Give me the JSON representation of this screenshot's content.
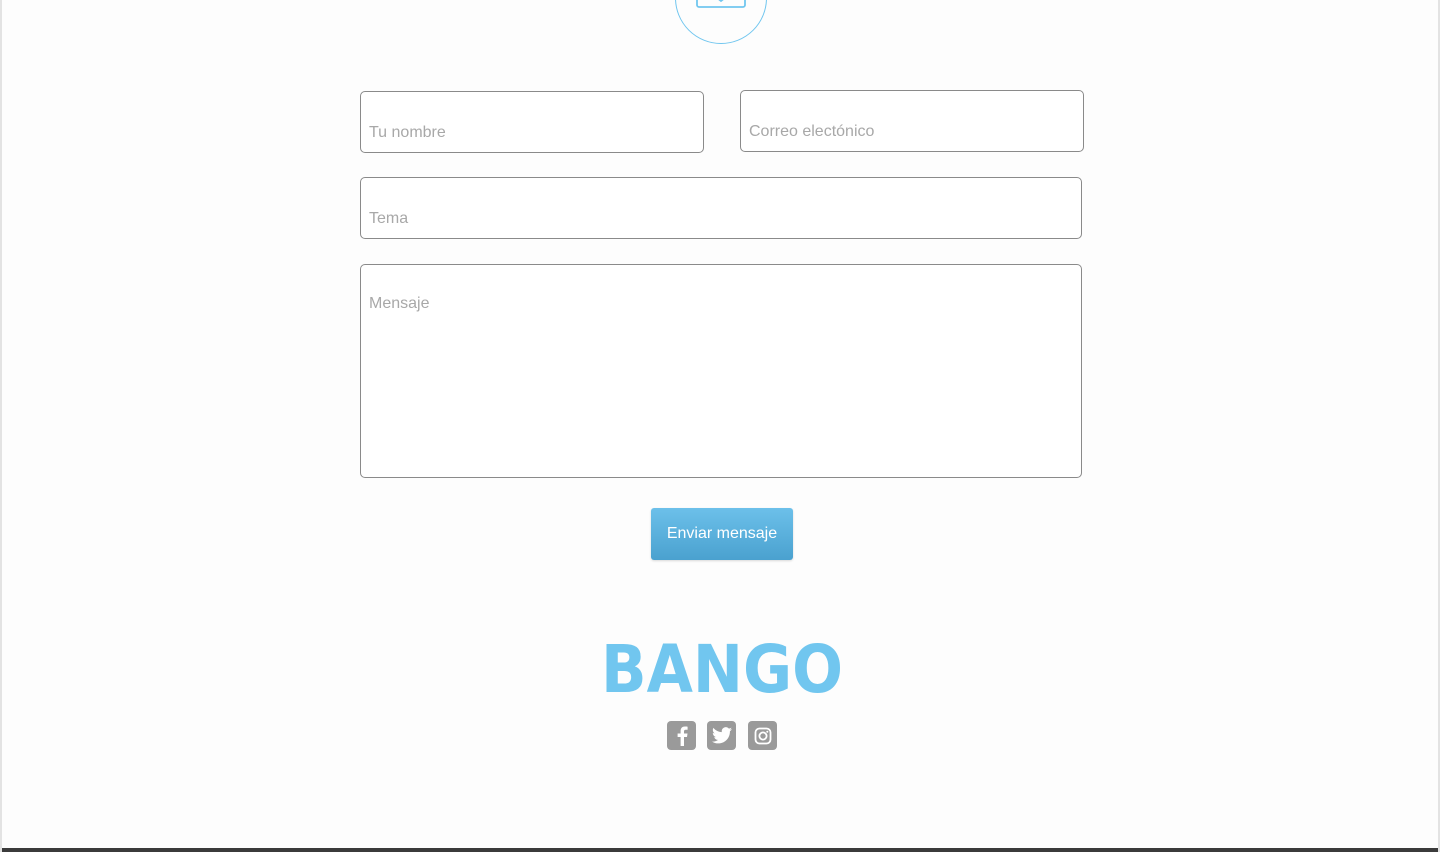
{
  "form": {
    "name_placeholder": "Tu nombre",
    "email_placeholder": "Correo electónico",
    "subject_placeholder": "Tema",
    "message_placeholder": "Mensaje",
    "submit_label": "Enviar mensaje"
  },
  "footer": {
    "logo_text": "BANGO",
    "social": [
      {
        "name": "facebook-icon"
      },
      {
        "name": "twitter-icon"
      },
      {
        "name": "instagram-icon"
      }
    ]
  },
  "colors": {
    "accent": "#71c6ef",
    "button_top": "#6cc0ea",
    "button_bottom": "#4aa1cf",
    "social_icon_bg": "#9a9a9a",
    "field_border": "#8a8a8a",
    "placeholder": "#a8a8a8"
  }
}
